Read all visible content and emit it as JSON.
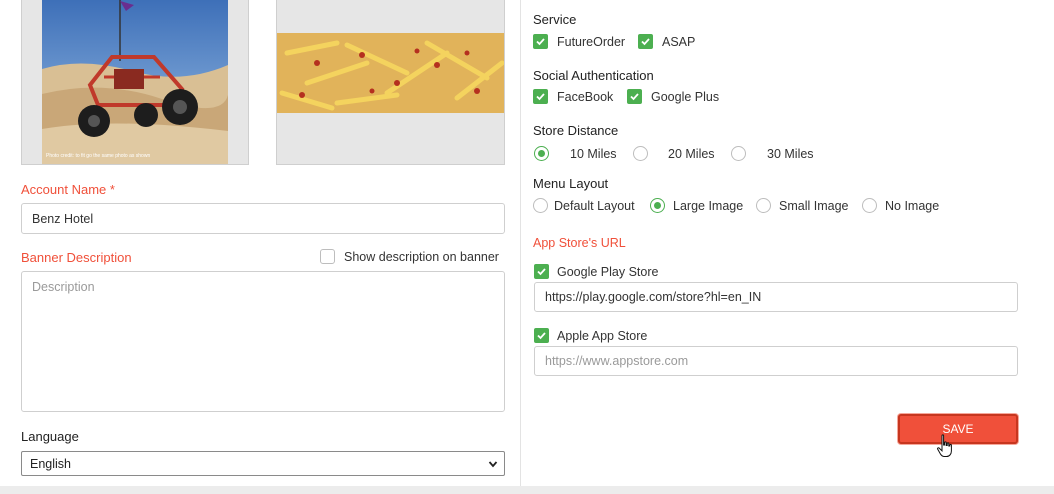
{
  "account": {
    "name_label": "Account Name",
    "required_mark": "*",
    "name_value": "Benz Hotel"
  },
  "banner": {
    "label": "Banner Description",
    "show_on_banner_label": "Show description on banner",
    "placeholder": "Description"
  },
  "language": {
    "label": "Language",
    "selected": "English"
  },
  "images": {
    "image1_caption": "Photo credit: to fit go the same photo as shown"
  },
  "service": {
    "label": "Service",
    "options": [
      {
        "label": "FutureOrder",
        "checked": true
      },
      {
        "label": "ASAP",
        "checked": true
      }
    ]
  },
  "social": {
    "label": "Social Authentication",
    "options": [
      {
        "label": "FaceBook",
        "checked": true
      },
      {
        "label": "Google Plus",
        "checked": true
      }
    ]
  },
  "distance": {
    "label": "Store Distance",
    "options": [
      {
        "label": "10 Miles",
        "selected": true
      },
      {
        "label": "20 Miles",
        "selected": false
      },
      {
        "label": "30 Miles",
        "selected": false
      }
    ]
  },
  "menu_layout": {
    "label": "Menu Layout",
    "options": [
      {
        "label": "Default Layout",
        "selected": false
      },
      {
        "label": "Large Image",
        "selected": true
      },
      {
        "label": "Small Image",
        "selected": false
      },
      {
        "label": "No Image",
        "selected": false
      }
    ]
  },
  "app_store": {
    "label": "App Store's URL",
    "google_label": "Google Play Store",
    "google_checked": true,
    "google_value": "https://play.google.com/store?hl=en_IN",
    "apple_label": "Apple App Store",
    "apple_checked": true,
    "apple_placeholder": "https://www.appstore.com"
  },
  "actions": {
    "save_label": "SAVE"
  },
  "colors": {
    "accent_red": "#f0503a",
    "check_green": "#4caf50"
  }
}
